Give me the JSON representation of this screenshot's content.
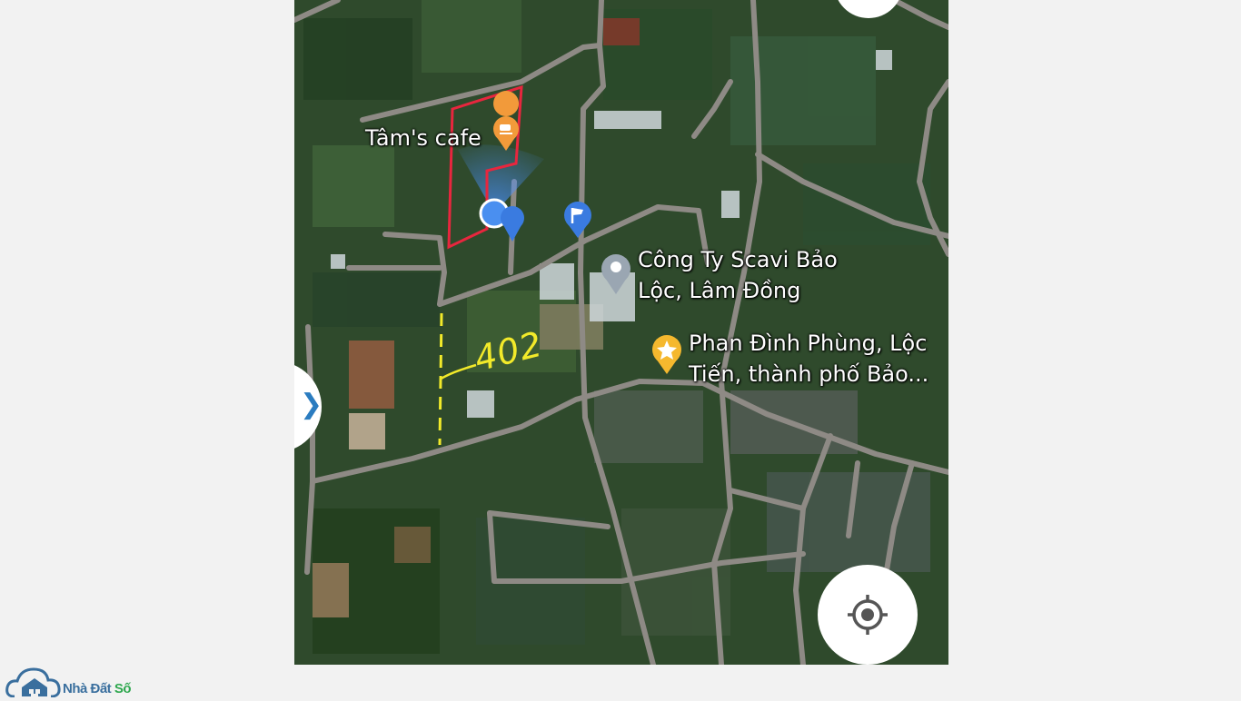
{
  "map": {
    "places": [
      {
        "name": "Tâm's cafe",
        "icon": "cafe-pin-icon"
      },
      {
        "name_line1": "Công Ty Scavi Bảo",
        "name_line2": "Lộc, Lâm Đồng",
        "icon": "place-pin-icon"
      },
      {
        "name_line1": "Phan Đình Phùng, Lộc",
        "name_line2": "Tiến, thành phố Bảo...",
        "icon": "star-pin-icon"
      }
    ],
    "annotation": "402",
    "colors": {
      "boundary": "#e8263e",
      "handwriting": "#f2ea2a",
      "road": "#8e8a85",
      "pin_blue": "#3a7be0",
      "pin_orange": "#f29a3a",
      "pin_yellow": "#f5b82e",
      "pin_gray": "#9aa6b2"
    }
  },
  "controls": {
    "side_toggle": "chevron-right-icon",
    "locate_button": "my-location-icon"
  },
  "brand": {
    "name_part1": "Nhà Đất ",
    "name_part2": "Số"
  }
}
